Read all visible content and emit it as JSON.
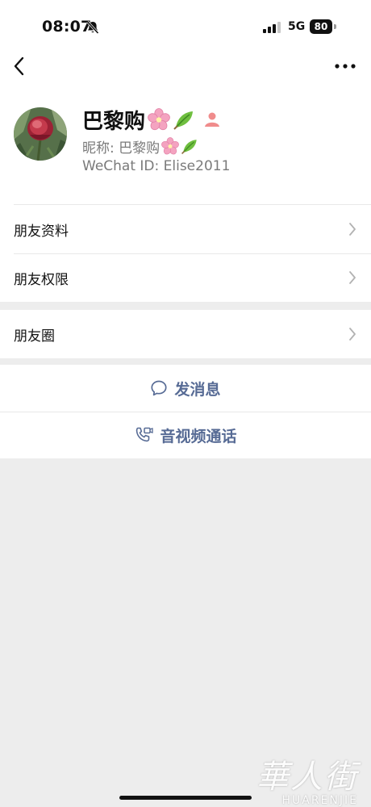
{
  "status_bar": {
    "time": "08:07",
    "network": "5G",
    "battery": "80",
    "icons": [
      "bell-muted-icon",
      "signal-icon"
    ]
  },
  "nav": {
    "back_icon": "chevron-left-icon",
    "more_icon": "more-dots-icon"
  },
  "profile": {
    "display_name": "巴黎购",
    "nickname_label": "昵称: 巴黎购",
    "wechat_id": "WeChat ID: Elise2011",
    "emojis": [
      "cherry-blossom-icon",
      "leaf-icon"
    ],
    "gender_icon": "contact-person-icon",
    "colors": {
      "secondary_text": "#7a7a7a",
      "gender": "#f08c8c"
    }
  },
  "menu": {
    "items": [
      {
        "label": "朋友资料"
      },
      {
        "label": "朋友权限"
      },
      {
        "label": "朋友圈"
      }
    ]
  },
  "actions": {
    "message": "发消息",
    "call": "音视频通话",
    "accent_color": "#576b95"
  },
  "watermark": {
    "cn": "華人街",
    "en": "HUARENJIE"
  }
}
